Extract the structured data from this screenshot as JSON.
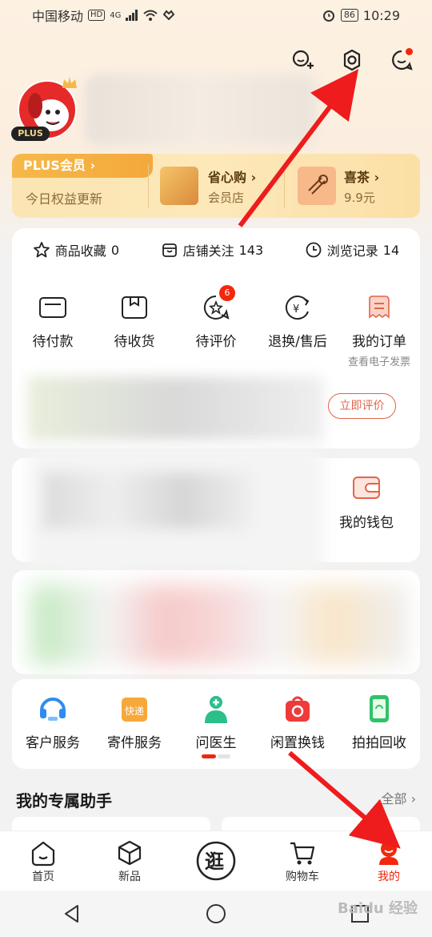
{
  "status_bar": {
    "carrier": "中国移动",
    "hd": "HD",
    "net": "4G",
    "battery": "86",
    "time": "10:29"
  },
  "profile": {
    "plus_tag": "PLUS"
  },
  "plus_strip": {
    "member_label": "PLUS会员 ›",
    "member_sub": "今日权益更新",
    "promo1_title": "省心购 ›",
    "promo1_sub": "会员店",
    "promo2_title": "喜茶 ›",
    "promo2_sub": "9.9元"
  },
  "stats": [
    {
      "label": "商品收藏",
      "count": "0"
    },
    {
      "label": "店铺关注",
      "count": "143"
    },
    {
      "label": "浏览记录",
      "count": "14"
    }
  ],
  "orders": [
    {
      "label": "待付款"
    },
    {
      "label": "待收货"
    },
    {
      "label": "待评价",
      "badge": "6"
    },
    {
      "label": "退换/售后"
    },
    {
      "label": "我的订单",
      "sub": "查看电子发票"
    }
  ],
  "review_button": "立即评价",
  "wallet_label": "我的钱包",
  "services": [
    {
      "label": "客户服务",
      "icon": "headset-icon"
    },
    {
      "label": "寄件服务",
      "icon": "express-box-icon",
      "icon_text": "快递"
    },
    {
      "label": "问医生",
      "icon": "doctor-icon"
    },
    {
      "label": "闲置换钱",
      "icon": "recycle-bag-icon"
    },
    {
      "label": "拍拍回收",
      "icon": "phone-recycle-icon"
    }
  ],
  "assistant": {
    "title": "我的专属助手",
    "all_link": "全部 ›"
  },
  "tabbar": [
    {
      "label": "首页"
    },
    {
      "label": "新品"
    },
    {
      "label": "逛"
    },
    {
      "label": "购物车"
    },
    {
      "label": "我的"
    }
  ],
  "watermark": "Baidu 经验",
  "colors": {
    "accent": "#f2270c",
    "plus_gold": "#f6b84a"
  }
}
